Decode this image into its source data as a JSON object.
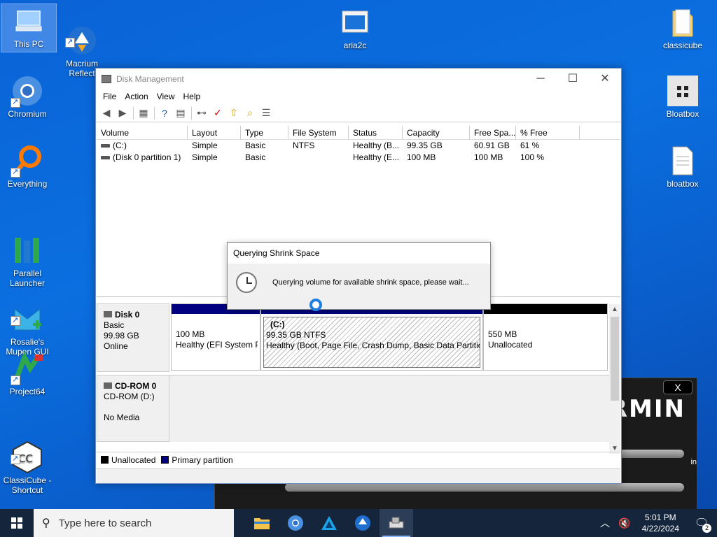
{
  "desktop": {
    "icons": [
      {
        "label": "This PC"
      },
      {
        "label": "Macrium\nReflect"
      },
      {
        "label": "aria2c"
      },
      {
        "label": "classicube"
      },
      {
        "label": "Chromium"
      },
      {
        "label": "Bloatbox"
      },
      {
        "label": "Everything"
      },
      {
        "label": "bloatbox"
      },
      {
        "label": "Parallel\nLauncher"
      },
      {
        "label": "Rosalie's\nMupen GUI"
      },
      {
        "label": "Project64"
      },
      {
        "label": "ClassiCube -\nShortcut"
      }
    ]
  },
  "bg_app": {
    "brand": "RMIN",
    "close": "X",
    "edge_text": "in"
  },
  "window": {
    "title": "Disk Management",
    "menu": [
      "File",
      "Action",
      "View",
      "Help"
    ],
    "columns": [
      "Volume",
      "Layout",
      "Type",
      "File System",
      "Status",
      "Capacity",
      "Free Spa...",
      "% Free"
    ],
    "rows": [
      [
        "(C:)",
        "Simple",
        "Basic",
        "NTFS",
        "Healthy (B...",
        "99.35 GB",
        "60.91 GB",
        "61 %"
      ],
      [
        "(Disk 0 partition 1)",
        "Simple",
        "Basic",
        "",
        "Healthy (E...",
        "100 MB",
        "100 MB",
        "100 %"
      ]
    ],
    "disks": [
      {
        "name": "Disk 0",
        "type": "Basic",
        "size": "99.98 GB",
        "state": "Online"
      },
      {
        "name": "CD-ROM 0",
        "type": "CD-ROM (D:)",
        "size": "",
        "state": "No Media"
      }
    ],
    "partitions": [
      {
        "title": "",
        "line1": "100 MB",
        "line2": "Healthy (EFI System P"
      },
      {
        "title": "(C:)",
        "line1": "99.35 GB NTFS",
        "line2": "Healthy (Boot, Page File, Crash Dump, Basic Data Partition"
      },
      {
        "title": "",
        "line1": "550 MB",
        "line2": "Unallocated"
      }
    ],
    "legend": [
      "Unallocated",
      "Primary partition"
    ],
    "colors": {
      "primary": "#000080",
      "unallocated": "#000000"
    }
  },
  "dialog": {
    "title": "Querying Shrink Space",
    "message": "Querying volume for available shrink space, please wait..."
  },
  "taskbar": {
    "search_placeholder": "Type here to search",
    "time": "5:01 PM",
    "date": "4/22/2024",
    "notifications": "2"
  }
}
